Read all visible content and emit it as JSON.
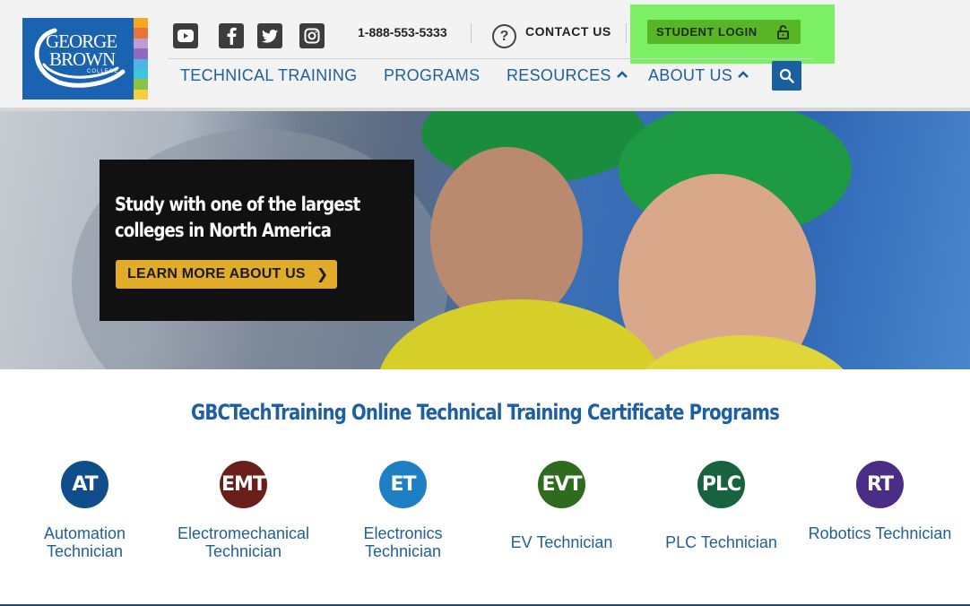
{
  "logo": {
    "line1": "GEORGE",
    "line2": "BROWN",
    "line3": "COLLEGE",
    "stripe_colors": [
      "#f5a623",
      "#e8743b",
      "#c39bd3",
      "#8e6bbf",
      "#4fb3e8",
      "#3ec6d8",
      "#8bc34a",
      "#f4d03f"
    ]
  },
  "header": {
    "social_icons": [
      "youtube-icon",
      "facebook-icon",
      "twitter-icon",
      "instagram-icon"
    ],
    "phone": "1-888-553-5333",
    "contact_label": "CONTACT US",
    "login_label": "STUDENT LOGIN",
    "highlight_color": "#7cf064"
  },
  "nav": {
    "items": [
      {
        "label": "TECHNICAL TRAINING",
        "dropdown": false
      },
      {
        "label": "PROGRAMS",
        "dropdown": false
      },
      {
        "label": "RESOURCES",
        "dropdown": true
      },
      {
        "label": "ABOUT US",
        "dropdown": true
      }
    ],
    "chevron": "^"
  },
  "hero": {
    "title": "Study with one of the largest colleges in North America",
    "button_label": "LEARN MORE ABOUT US",
    "button_arrow": "❯"
  },
  "programs": {
    "title": "GBCTechTraining Online Technical Training Certificate Programs",
    "items": [
      {
        "abbr": "AT",
        "name": "Automation Technician",
        "color": "#0f4e8a"
      },
      {
        "abbr": "EMT",
        "name": "Electromechanical Technician",
        "color": "#6b1f1a"
      },
      {
        "abbr": "ET",
        "name": "Electronics Technician",
        "color": "#1f7fc4"
      },
      {
        "abbr": "EVT",
        "name": "EV Technician",
        "color": "#2e6b1e"
      },
      {
        "abbr": "PLC",
        "name": "PLC Technician",
        "color": "#17623f"
      },
      {
        "abbr": "RT",
        "name": "Robotics Technician",
        "color": "#4b2d86"
      }
    ]
  }
}
